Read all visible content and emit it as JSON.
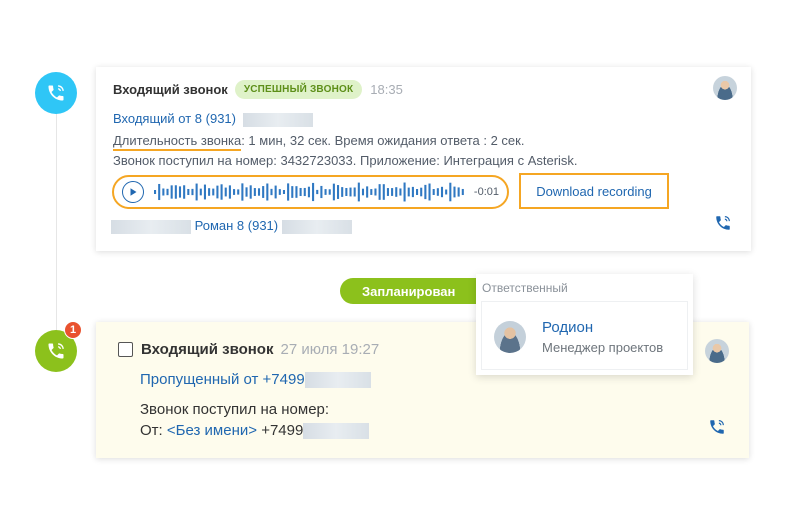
{
  "colors": {
    "accent_blue": "#2fc6f6",
    "accent_green": "#8cc11c",
    "highlight": "#f5a623",
    "link": "#2067b0"
  },
  "call1": {
    "icon": "phone-incoming-icon",
    "title": "Входящий звонок",
    "status": "УСПЕШНЫЙ ЗВОНОК",
    "time": "18:35",
    "incoming": "Входящий от 8 (931)",
    "duration_label": "Длительность звонка",
    "duration_value": ": 1 мин, 32 сек. Время ожидания ответа : 2 сек.",
    "number_line": "Звонок поступил на номер: 3432723033. Приложение: Интеграция с Asterisk.",
    "player_time": "-0:01",
    "download": "Download recording",
    "contact": "Роман 8 (931)"
  },
  "planned_label": "Запланирован",
  "responsible": {
    "header": "Ответственный",
    "name": "Родион",
    "role": "Менеджер проектов"
  },
  "call2": {
    "badge": "1",
    "title": "Входящий звонок",
    "time": "27 июля 19:27",
    "missed": "Пропущенный от +7499",
    "number_line": "Звонок поступил на номер:",
    "from_label": "От:",
    "from_name": "<Без имени>",
    "from_number": "+7499"
  }
}
